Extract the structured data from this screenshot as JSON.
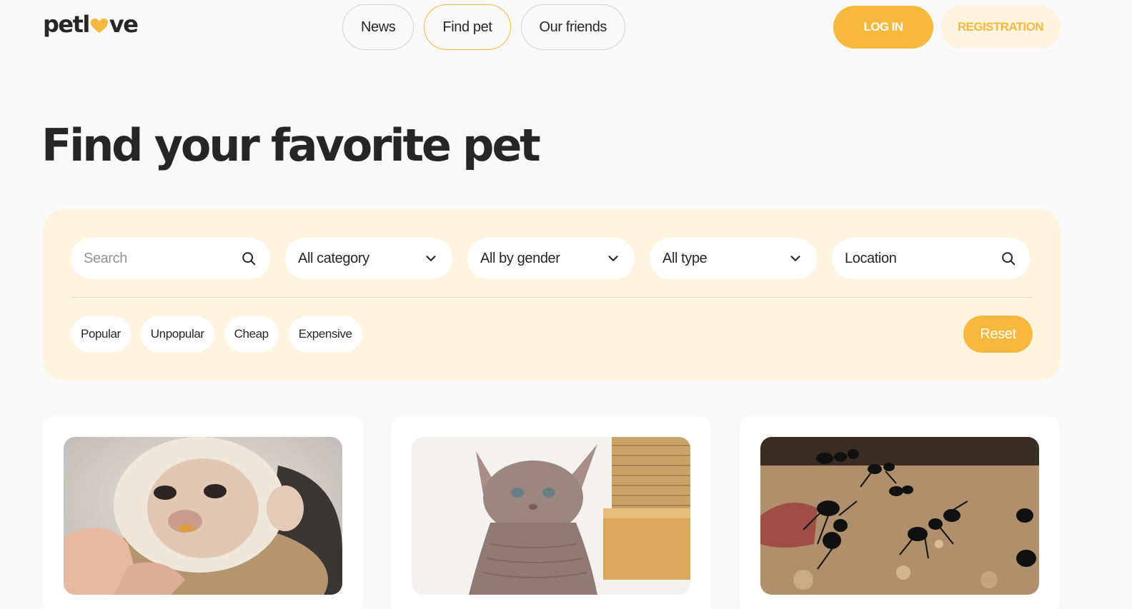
{
  "header": {
    "logo": {
      "prefix": "petl",
      "suffix": "ve",
      "heart_icon": "heart-icon"
    },
    "nav": [
      {
        "label": "News",
        "active": false
      },
      {
        "label": "Find pet",
        "active": true
      },
      {
        "label": "Our friends",
        "active": false
      }
    ],
    "login_label": "LOG IN",
    "registration_label": "REGISTRATION"
  },
  "page_title": "Find your favorite pet",
  "filters": {
    "search": {
      "placeholder": "Search",
      "value": "",
      "icon": "search-icon"
    },
    "category": {
      "selected": "All category",
      "icon": "chevron-down-icon"
    },
    "gender": {
      "selected": "All by gender",
      "icon": "chevron-down-icon"
    },
    "type": {
      "selected": "All type",
      "icon": "chevron-down-icon"
    },
    "location": {
      "value": "Location",
      "icon": "search-icon"
    },
    "sort_options": [
      "Popular",
      "Unpopular",
      "Cheap",
      "Expensive"
    ],
    "reset_label": "Reset"
  },
  "notices": [
    {
      "image": "capuchin-monkey-photo"
    },
    {
      "image": "sphynx-kitten-photo"
    },
    {
      "image": "black-ants-photo"
    }
  ],
  "colors": {
    "accent": "#f6b83d",
    "accent_light": "#fff4df",
    "text": "#262626",
    "background": "#f9f9f9"
  }
}
